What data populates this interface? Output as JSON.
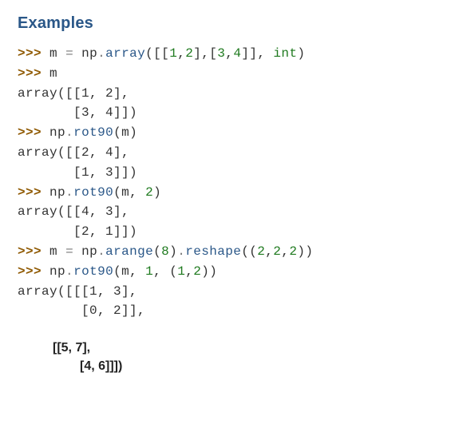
{
  "heading": "Examples",
  "prompt": ">>>",
  "ids": {
    "m": "m",
    "np": "np",
    "int": "int"
  },
  "ops": {
    "eq": "=",
    "dot": "."
  },
  "methods": {
    "array": "array",
    "rot90": "rot90",
    "arange": "arange",
    "reshape": "reshape"
  },
  "p": {
    "op": "(",
    "cp": ")",
    "ob": "[",
    "cb": "]",
    "comma": ","
  },
  "nums": {
    "n0": "0",
    "n1": "1",
    "n2": "2",
    "n3": "3",
    "n4": "4",
    "n5": "5",
    "n6": "6",
    "n7": "7",
    "n8": "8"
  },
  "outputs": {
    "out1a": "array([[1, 2],",
    "out1b": "       [3, 4]])",
    "out2a": "array([[2, 4],",
    "out2b": "       [1, 3]])",
    "out3a": "array([[4, 3],",
    "out3b": "       [2, 1]])",
    "out4a": "array([[[1, 3],",
    "out4b": "        [0, 2]],"
  },
  "trail": {
    "l1": "[[5, 7],",
    "l2": " [4, 6]]])"
  }
}
